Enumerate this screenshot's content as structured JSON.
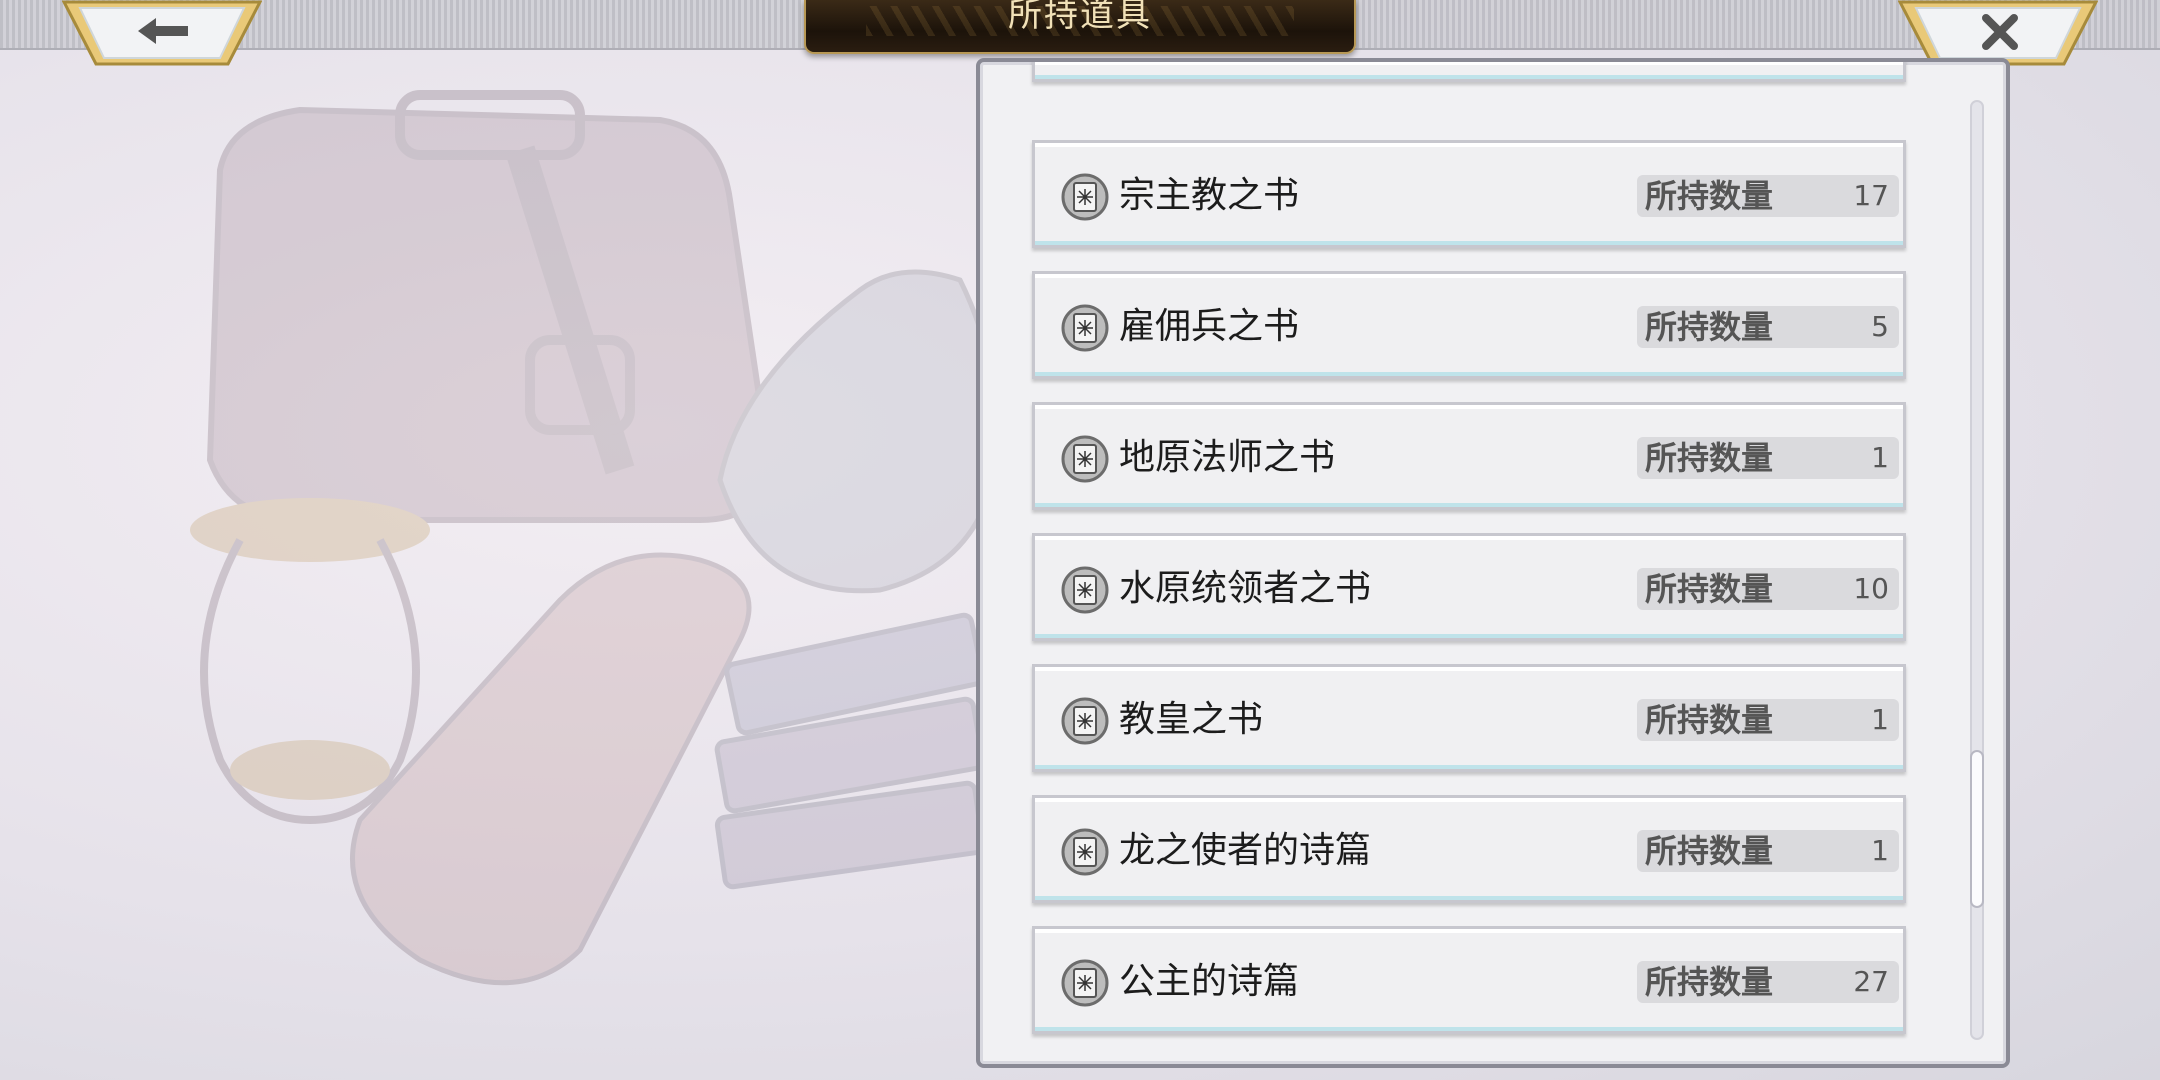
{
  "header": {
    "title": "所持道具",
    "back_icon": "arrow-left-icon",
    "close_icon": "close-icon"
  },
  "inventory": {
    "quantity_label": "所持数量",
    "items": [
      {
        "name": "",
        "quantity": ""
      },
      {
        "name": "宗主教之书",
        "quantity": "17"
      },
      {
        "name": "雇佣兵之书",
        "quantity": "5"
      },
      {
        "name": "地原法师之书",
        "quantity": "1"
      },
      {
        "name": "水原统领者之书",
        "quantity": "10"
      },
      {
        "name": "教皇之书",
        "quantity": "1"
      },
      {
        "name": "龙之使者的诗篇",
        "quantity": "1"
      },
      {
        "name": "公主的诗篇",
        "quantity": "27"
      }
    ],
    "item_icon": "book-icon"
  },
  "scroll": {
    "position_fraction": 0.72
  },
  "colors": {
    "title_bg": "#1c130a",
    "title_text": "#f1e1b8",
    "frame_gold": "#d4bf6a",
    "item_bg": "#f0f0f2"
  }
}
